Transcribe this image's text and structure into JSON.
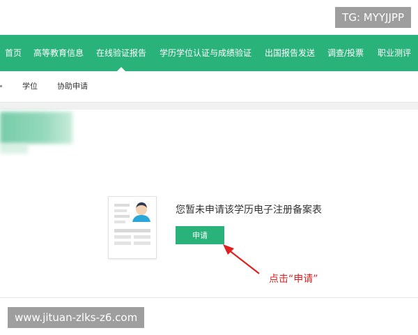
{
  "watermark_top": "TG: MYYJJPP",
  "watermark_bottom": "www.jituan-zlks-z6.com",
  "colors": {
    "brand_green": "#2ab27b",
    "annotation_red": "#e02020"
  },
  "nav": {
    "items": [
      {
        "label": "首页"
      },
      {
        "label": "高等教育信息"
      },
      {
        "label": "在线验证报告",
        "active": true
      },
      {
        "label": "学历学位认证与成绩验证"
      },
      {
        "label": "出国报告发送"
      },
      {
        "label": "调查/投票"
      },
      {
        "label": "职业测评"
      }
    ]
  },
  "subnav": {
    "items": [
      {
        "label": "学位"
      },
      {
        "label": "协助申请"
      }
    ]
  },
  "empty_state": {
    "message": "您暂未申请该学历电子注册备案表",
    "button_label": "申请",
    "illustration_icon": "resume-document-icon"
  },
  "annotation": {
    "text": "点击“申请”"
  }
}
